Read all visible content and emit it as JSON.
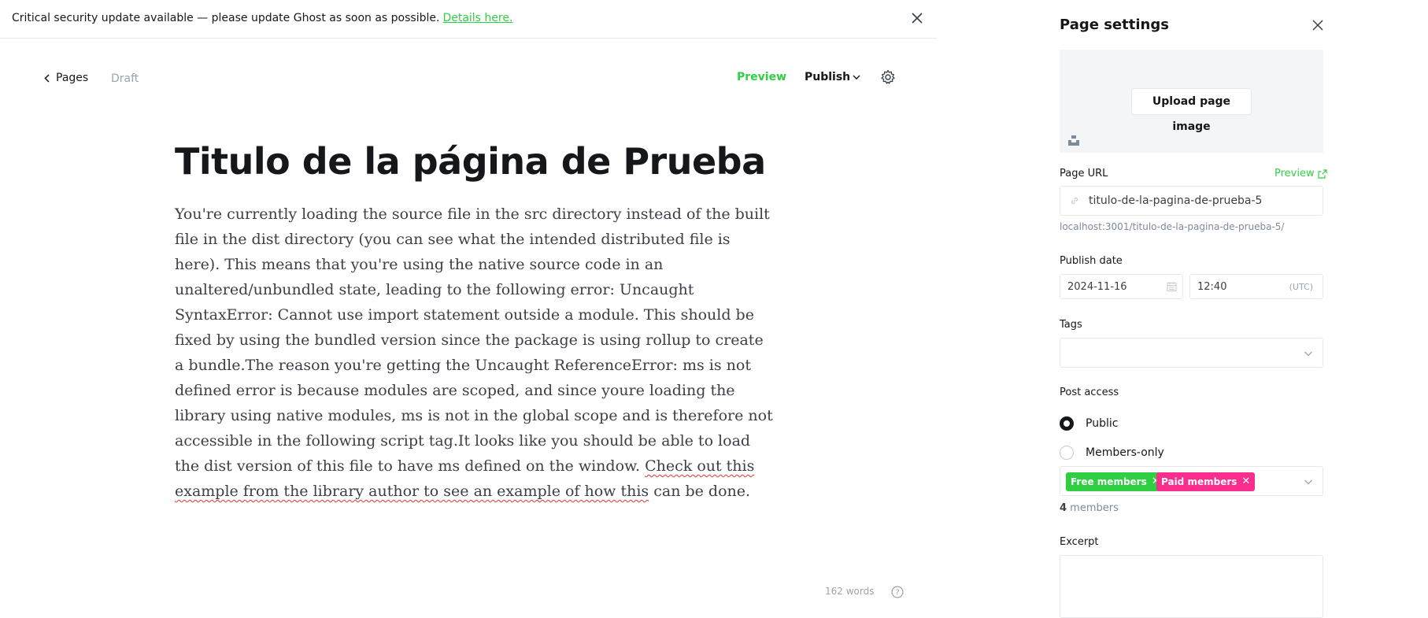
{
  "banner": {
    "text": "Critical security update available — please update Ghost as soon as possible.",
    "link": "Details here."
  },
  "header": {
    "back_label": "Pages",
    "status": "Draft",
    "preview_label": "Preview",
    "publish_label": "Publish"
  },
  "post": {
    "title": "Titulo de la página de Prueba",
    "body_plain": "You're currently loading the source file in the src directory instead of the built file in the dist directory (you can see what the intended distributed file is here). This means that you're using the native source code in an unaltered/unbundled state, leading to the following error: Uncaught SyntaxError: Cannot use import statement outside a module. This should be fixed by using the bundled version since the package is using rollup to create a bundle.The reason you're getting the Uncaught ReferenceError: ms is not defined error is because modules are scoped, and since youre loading the library using native modules, ms is not in the global scope and is therefore not accessible in the following script tag.It looks like you should be able to load the dist version of this file to have ms defined on the window. ",
    "body_squiggle": "Check out this example from the library author to see an example of how this",
    "body_tail": " can be done.",
    "word_count": "162 words"
  },
  "settings": {
    "title": "Page settings",
    "upload_label": "Upload page image",
    "page_url_label": "Page URL",
    "url_preview_label": "Preview",
    "slug": "titulo-de-la-pagina-de-prueba-5",
    "full_url": "localhost:3001/titulo-de-la-pagina-de-prueba-5/",
    "publish_date_label": "Publish date",
    "date": "2024-11-16",
    "time": "12:40",
    "timezone": "(UTC)",
    "tags_label": "Tags",
    "post_access_label": "Post access",
    "access_options": [
      "Public",
      "Members-only"
    ],
    "selected_access": "Public",
    "tiers": [
      "Free members",
      "Paid members"
    ],
    "members_count": "4",
    "members_suffix": " members",
    "excerpt_label": "Excerpt",
    "colors": {
      "accent": "#30cf43",
      "paid": "#fb2d8d",
      "text": "#15171a"
    }
  }
}
